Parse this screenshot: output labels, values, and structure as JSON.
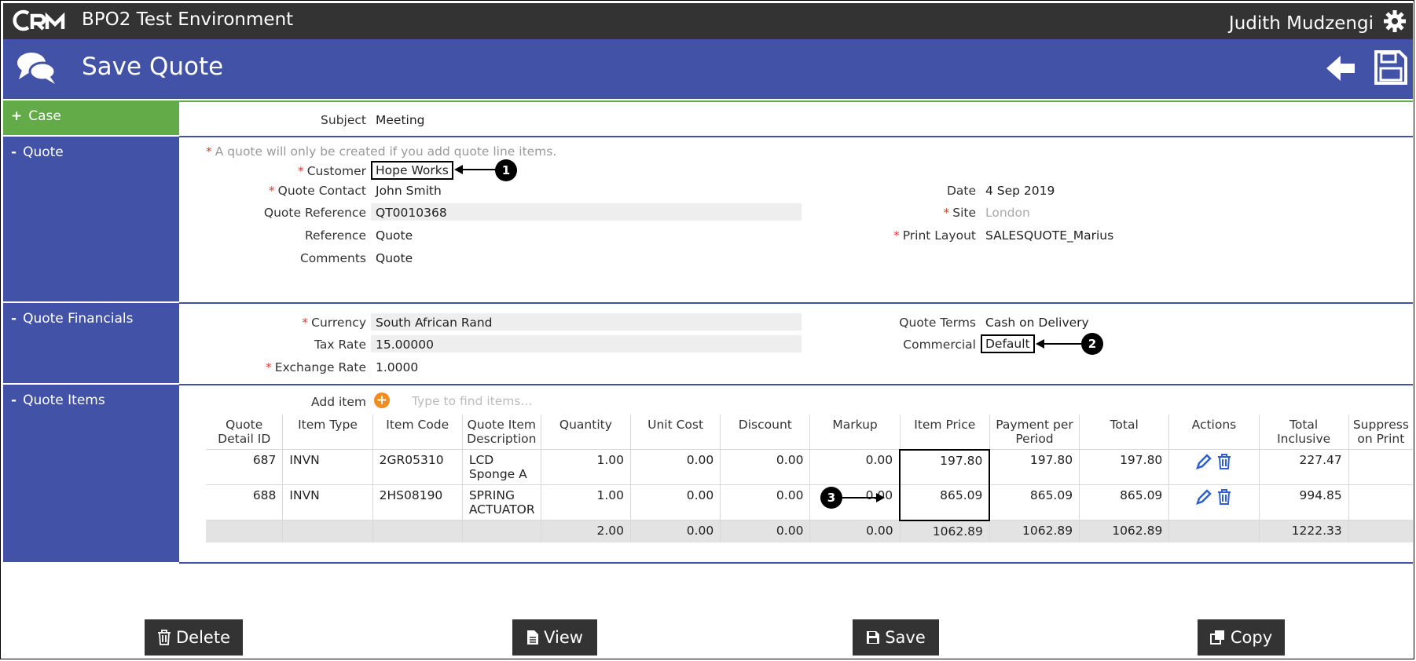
{
  "app": {
    "environment": "BPO2 Test Environment",
    "user": "Judith Mudzengi",
    "page_title": "Save Quote"
  },
  "sections": {
    "case": "Case",
    "quote": "Quote",
    "financials": "Quote Financials",
    "items": "Quote Items"
  },
  "case": {
    "subject_label": "Subject",
    "subject_value": "Meeting"
  },
  "quote": {
    "notice": "A quote will only be created if you add quote line items.",
    "customer_label": "Customer",
    "customer_value": "Hope Works",
    "contact_label": "Quote Contact",
    "contact_value": "John Smith",
    "ref_label": "Quote Reference",
    "ref_value": "QT0010368",
    "reference_label": "Reference",
    "reference_value": "Quote",
    "comments_label": "Comments",
    "comments_value": "Quote",
    "date_label": "Date",
    "date_value": "4 Sep 2019",
    "site_label": "Site",
    "site_value": "London",
    "print_label": "Print Layout",
    "print_value": "SALESQUOTE_Marius"
  },
  "financials": {
    "currency_label": "Currency",
    "currency_value": "South African Rand",
    "tax_label": "Tax Rate",
    "tax_value": "15.00000",
    "exchange_label": "Exchange Rate",
    "exchange_value": "1.0000",
    "terms_label": "Quote Terms",
    "terms_value": "Cash on Delivery",
    "commercial_label": "Commercial",
    "commercial_value": "Default"
  },
  "items": {
    "add_label": "Add item",
    "find_placeholder": "Type to find items...",
    "headers": [
      "Quote Detail ID",
      "Item Type",
      "Item Code",
      "Quote Item Description",
      "Quantity",
      "Unit Cost",
      "Discount",
      "Markup",
      "Item Price",
      "Payment per Period",
      "Total",
      "Actions",
      "Total Inclusive",
      "Suppress on Print"
    ],
    "rows": [
      {
        "id": "687",
        "type": "INVN",
        "code": "2GR05310",
        "desc": "LCD Sponge A",
        "qty": "1.00",
        "unit_cost": "0.00",
        "discount": "0.00",
        "markup": "0.00",
        "item_price": "197.80",
        "ppp": "197.80",
        "total": "197.80",
        "total_incl": "227.47"
      },
      {
        "id": "688",
        "type": "INVN",
        "code": "2HS08190",
        "desc": "SPRING ACTUATOR",
        "qty": "1.00",
        "unit_cost": "0.00",
        "discount": "0.00",
        "markup": "0.00",
        "item_price": "865.09",
        "ppp": "865.09",
        "total": "865.09",
        "total_incl": "994.85"
      }
    ],
    "totals": {
      "qty": "2.00",
      "unit_cost": "0.00",
      "discount": "0.00",
      "markup": "0.00",
      "item_price": "1062.89",
      "ppp": "1062.89",
      "total": "1062.89",
      "total_incl": "1222.33"
    }
  },
  "markers": [
    "1",
    "2",
    "3"
  ],
  "buttons": {
    "delete": "Delete",
    "view": "View",
    "save": "Save",
    "copy": "Copy"
  },
  "colors": {
    "header_blue": "#4252a6",
    "case_green": "#62ab48",
    "top_bar": "#333333",
    "required": "#e53935",
    "add_orange": "#f28c1e",
    "icon_blue": "#2f5fd0"
  },
  "icons": [
    "crm-logo",
    "gear-icon",
    "chat-bubbles-icon",
    "back-arrow-icon",
    "save-disk-icon",
    "edit-pencil-icon",
    "trash-icon",
    "add-circle-icon",
    "document-icon",
    "copy-icon"
  ]
}
